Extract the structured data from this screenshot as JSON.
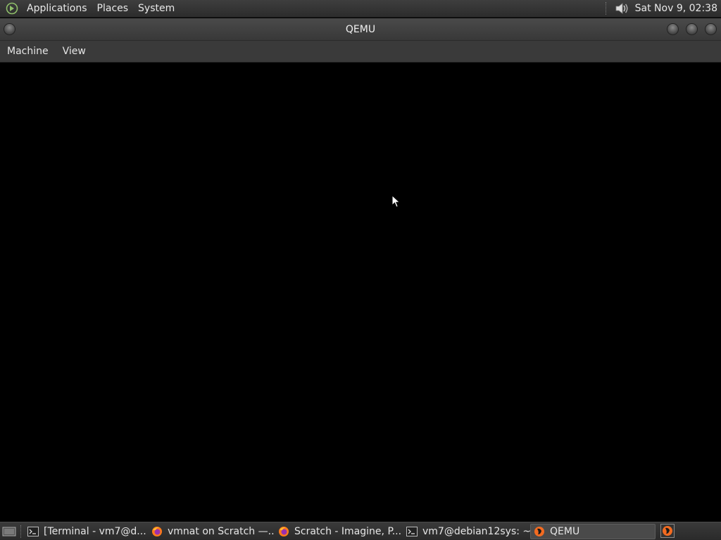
{
  "top_panel": {
    "menus": [
      "Applications",
      "Places",
      "System"
    ],
    "clock": "Sat Nov  9, 02:38",
    "icons": {
      "logo": "distro-logo-icon",
      "volume": "volume-icon"
    }
  },
  "window": {
    "title": "QEMU",
    "menubar": [
      "Machine",
      "View"
    ]
  },
  "taskbar": {
    "tasks": [
      {
        "label": "[Terminal - vm7@d...",
        "icon": "terminal-icon"
      },
      {
        "label": "vmnat on Scratch —...",
        "icon": "firefox-icon"
      },
      {
        "label": "Scratch - Imagine, P...",
        "icon": "firefox-icon"
      },
      {
        "label": "vm7@debian12sys: ~",
        "icon": "terminal-icon"
      },
      {
        "label": "QEMU",
        "icon": "qemu-icon",
        "active": true
      }
    ]
  },
  "colors": {
    "panel_bg": "#333333",
    "vm_bg": "#000000",
    "text": "#e6e6e6"
  }
}
